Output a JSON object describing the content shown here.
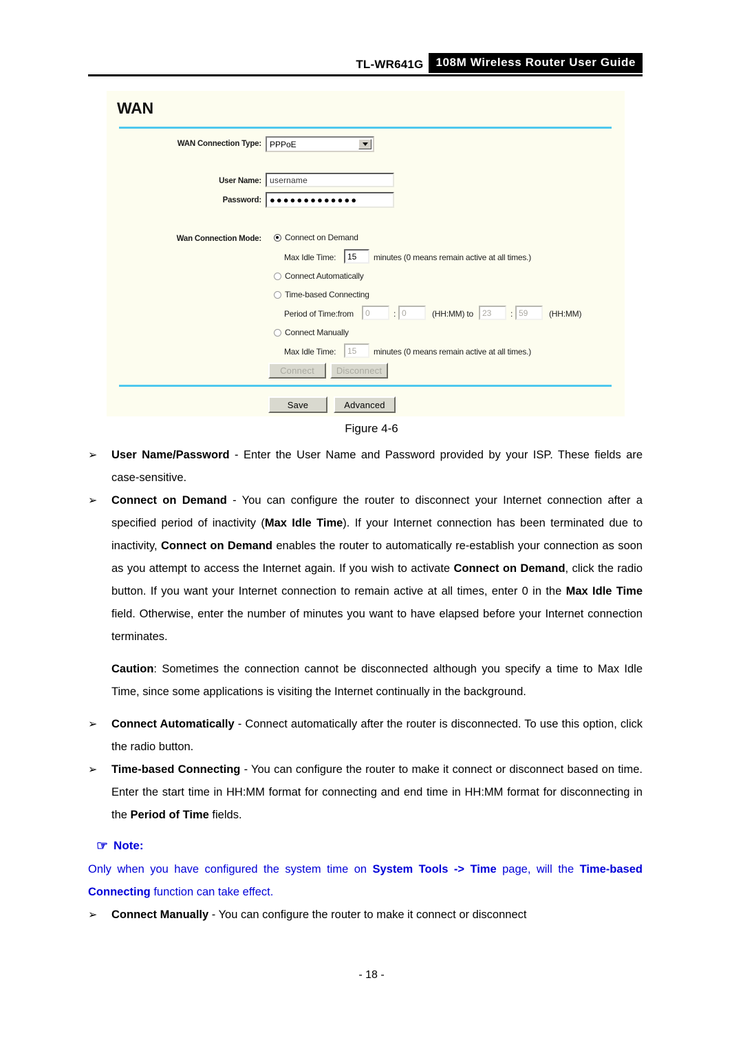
{
  "header": {
    "model": "TL-WR641G",
    "guide_title": "108M Wireless Router User Guide"
  },
  "figure": {
    "caption": "Figure 4-6",
    "panel": {
      "title": "WAN",
      "labels": {
        "wan_connection_type": "WAN Connection Type:",
        "user_name": "User Name:",
        "password": "Password:",
        "wan_connection_mode": "Wan Connection Mode:"
      },
      "fields": {
        "connection_type_value": "PPPoE",
        "user_name_value": "username",
        "password_value": "●●●●●●●●●●●●●"
      },
      "radios": [
        {
          "label": "Connect on Demand",
          "checked": true
        },
        {
          "label": "Connect Automatically",
          "checked": false
        },
        {
          "label": "Time-based Connecting",
          "checked": false
        },
        {
          "label": "Connect Manually",
          "checked": false
        }
      ],
      "idle_demand": {
        "label": "Max Idle Time:",
        "value": "15",
        "suffix": "minutes (0 means remain active at all times.)"
      },
      "period": {
        "label": "Period of Time:from",
        "from_hh": "0",
        "from_mm": "0",
        "colon": ":",
        "format_1": "(HH:MM) to",
        "to_hh": "23",
        "to_mm": "59",
        "format_2": "(HH:MM)"
      },
      "idle_manual": {
        "label": "Max Idle Time:",
        "value": "15",
        "suffix": "minutes (0 means remain active at all times.)"
      },
      "buttons": {
        "connect": "Connect",
        "disconnect": "Disconnect",
        "save": "Save",
        "advanced": "Advanced"
      }
    }
  },
  "content": {
    "bullet_glyph": "➢",
    "items": [
      {
        "term": "User Name/Password",
        "dash": " - ",
        "text": "Enter the User Name and Password provided by your ISP. These fields are case-sensitive."
      }
    ],
    "demand_bullet": {
      "term": "Connect on Demand",
      "dash": " - ",
      "p1": "You can configure the router to disconnect your Internet connection after a specified period of inactivity (",
      "b1": "Max Idle Time",
      "p2": "). If your Internet connection has been terminated due to inactivity, ",
      "b2": "Connect on Demand",
      "p3": " enables the router to automatically re-establish your connection as soon as you attempt to access the Internet again. If you wish to activate ",
      "b3": "Connect on Demand",
      "p4": ", click the radio button. If you want your Internet connection to remain active at all times, enter 0 in the ",
      "b4": "Max Idle Time",
      "p5": " field. Otherwise, enter the number of minutes you want to have elapsed before your Internet connection terminates."
    },
    "caution": {
      "term": "Caution",
      "text": ": Sometimes the connection cannot be disconnected although you specify a time to Max Idle Time, since some applications is visiting the Internet continually in the background."
    },
    "auto_bullet": {
      "term": "Connect Automatically",
      "dash": " - ",
      "text": "Connect automatically after the router is disconnected. To use this option, click the radio button."
    },
    "timebased_bullet": {
      "term": "Time-based Connecting",
      "dash": " - ",
      "p1": "You can configure the router to make it connect or disconnect based on time. Enter the start time in HH:MM format for connecting and end time in HH:MM format for disconnecting in the ",
      "b1": "Period of Time",
      "p2": " fields."
    },
    "note": {
      "hand_glyph": "☞",
      "title": "Note:",
      "p1": "Only when you have configured the system time on ",
      "b1": "System Tools -> Time",
      "p2": " page, will the ",
      "b2": "Time-based Connecting",
      "p3": " function can take effect."
    },
    "manual_bullet": {
      "term": "Connect Manually",
      "dash": " - ",
      "text": "You can configure the router to make it connect or disconnect"
    }
  },
  "footer": {
    "page_number": "- 18 -"
  }
}
